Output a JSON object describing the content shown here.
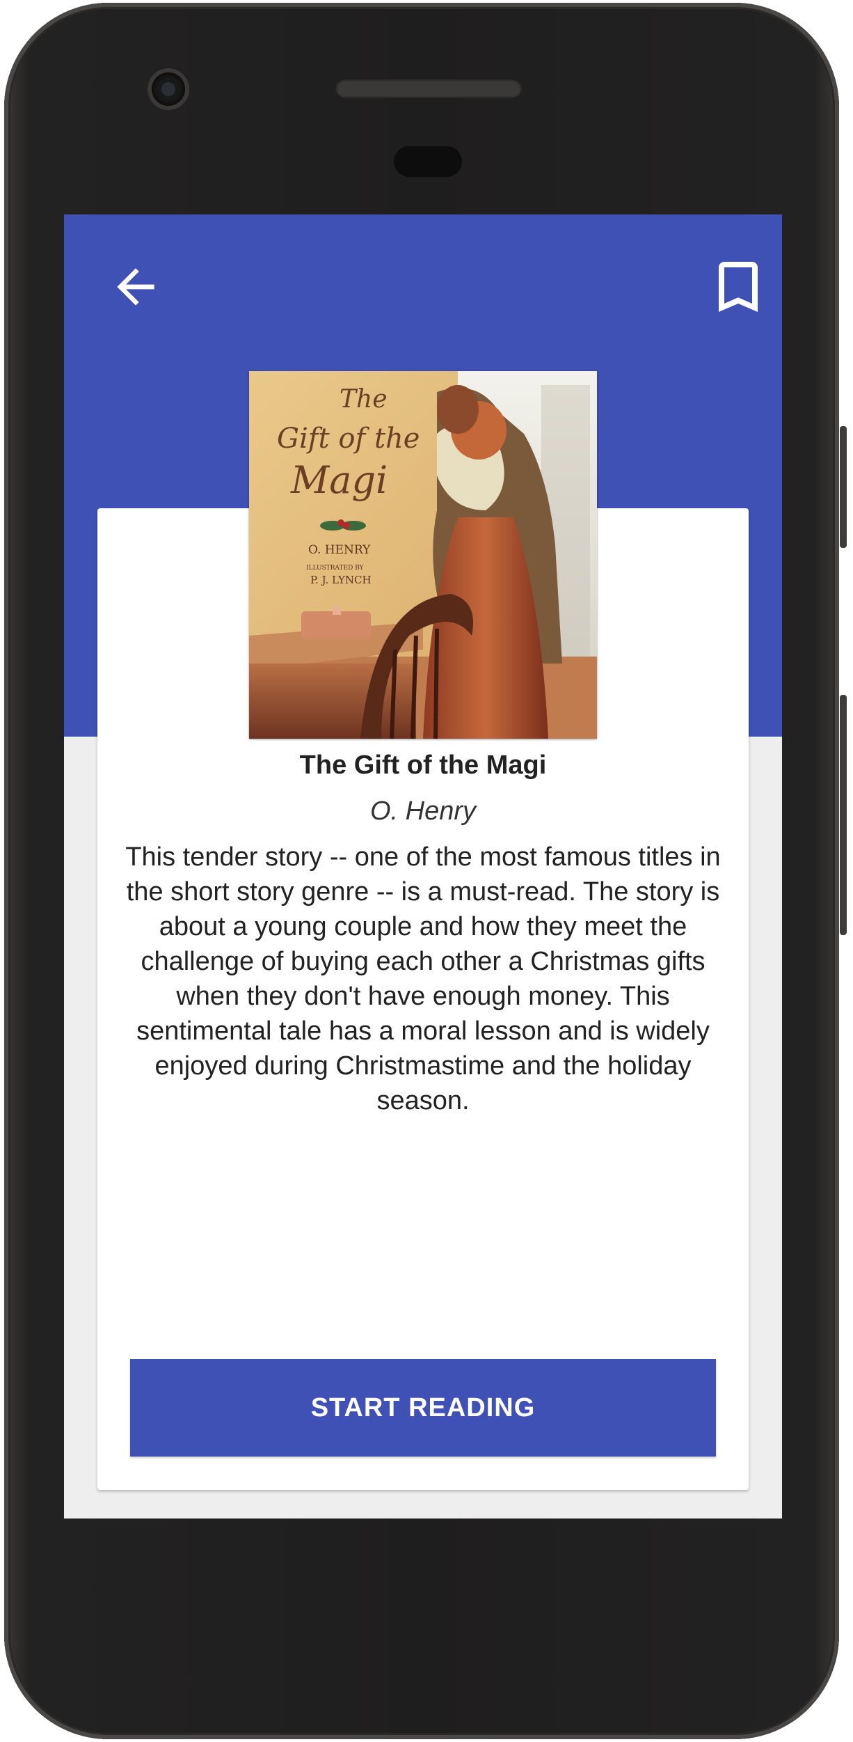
{
  "appbar": {
    "color": "#3f51b5",
    "back_icon": "arrow-back-icon",
    "bookmark_icon": "bookmark-outline-icon"
  },
  "book": {
    "title": "The Gift of the Magi",
    "author": "O. Henry",
    "description": "This tender story -- one of the most famous titles in the short story genre -- is a must-read. The story is about a young couple and how they meet the challenge of buying each other a Christmas gifts when they don't have enough money. This sentimental tale has a moral lesson and is widely enjoyed during Christmastime and the holiday season.",
    "cover": {
      "title_line1": "The",
      "title_line2": "Gift of the",
      "title_line3": "Magi",
      "author": "O. HENRY",
      "illustrated_by": "ILLUSTRATED BY",
      "illustrator": "P. J. LYNCH"
    }
  },
  "actions": {
    "start_label": "START READING"
  }
}
